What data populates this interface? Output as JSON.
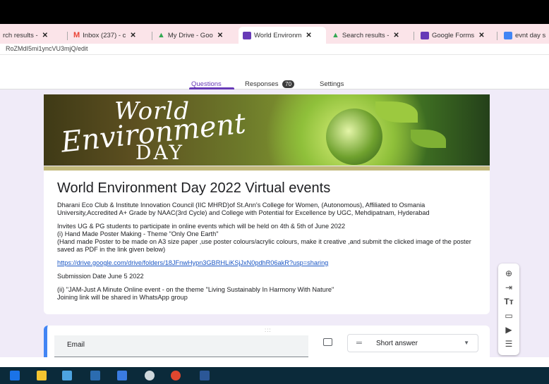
{
  "browser": {
    "tabs": [
      {
        "label": "rch results -",
        "icon": "search-results-icon",
        "color": "#f4b400"
      },
      {
        "label": "Inbox (237) - c",
        "icon": "gmail-icon",
        "color": "#ea4335"
      },
      {
        "label": "My Drive - Goo",
        "icon": "drive-icon",
        "color": "#34a853"
      },
      {
        "label": "World Environm",
        "icon": "forms-icon",
        "color": "#673ab7",
        "active": true
      },
      {
        "label": "Search results -",
        "icon": "drive-icon",
        "color": "#34a853"
      },
      {
        "label": "Google Forms",
        "icon": "forms-icon",
        "color": "#673ab7"
      },
      {
        "label": "evnt day s",
        "icon": "docs-icon",
        "color": "#4285f4"
      }
    ],
    "url": "RoZMdI5mi1yncVU3mjQ/edit"
  },
  "form_tabs": {
    "questions": "Questions",
    "responses": "Responses",
    "responses_count": "70",
    "settings": "Settings"
  },
  "banner": {
    "line1": "World",
    "line2": "Environment",
    "line3": "DAY"
  },
  "form": {
    "title": "World Environment Day 2022 Virtual events",
    "description": {
      "p1": "Dharani Eco Club & Institute Innovation Council (IIC MHRD)of St.Ann's College for Women, (Autonomous), Affiliated to Osmania University,Accredited A+ Grade by NAAC(3rd Cycle) and College with Potential for Excellence by UGC, Mehdipatnam, Hyderabad",
      "p2a": "Invites UG & PG students to participate in  online events which will be held on 4th & 5th of June 2022",
      "p2b": "(i) Hand Made Poster Making - Theme \"Only One Earth\"",
      "p2c": "(Hand made Poster to be  made on A3 size paper ,use poster colours/acrylic colours, make it creative ,and submit the clicked image of the poster saved as PDF in the link given below)",
      "link": "https://drive.google.com/drive/folders/18JFnwHypn3GBRHLiKSjJxN0pdhR06akR?usp=sharing",
      "submission": "Submission Date June 5 2022",
      "p4a": "(ii) \"JAM-Just A Minute Online  event - on the theme \"Living Sustainably In Harmony With  Nature\"",
      "p4b": "Joining link will be shared in WhatsApp group"
    }
  },
  "question": {
    "drag_handle": ":::",
    "title": "Email",
    "type": "Short answer"
  },
  "sidebar_icons": [
    "add-question-icon",
    "import-questions-icon",
    "add-title-icon",
    "add-image-icon",
    "add-video-icon",
    "add-section-icon"
  ]
}
